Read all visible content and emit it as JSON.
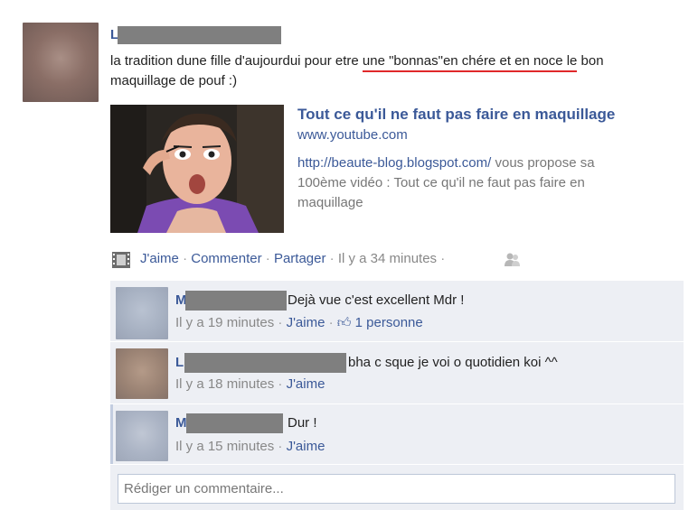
{
  "post": {
    "author_initial": "L",
    "text_line1_a": "la tradition dune fille d'aujourdui pour etre ",
    "text_line1_b": "une \"bonnas\"en chére et en noce le",
    "text_line1_c": " bon",
    "text_line2": "maquillage de pouf :)",
    "link": {
      "title": "Tout ce qu'il ne faut pas faire en maquillage",
      "domain": "www.youtube.com",
      "desc_link": "http://beaute-blog.blogspot.com/",
      "desc_line1_rest": " vous propose sa",
      "desc_line2": "100ème vidéo : Tout ce qu'il ne faut pas faire en",
      "desc_line3": "maquillage"
    },
    "actions": {
      "like": "J'aime",
      "comment": "Commenter",
      "share": "Partager",
      "time": "Il y a 34 minutes",
      "sep": "·"
    }
  },
  "comments": [
    {
      "initial": "M",
      "text": "Dejà vue c'est excellent Mdr !",
      "time": "Il y a 19 minutes",
      "like": "J'aime",
      "likes_count": "1 personne"
    },
    {
      "initial": "L",
      "text": "bha c sque je voi o quotidien koi ^^",
      "time": "Il y a 18 minutes",
      "like": "J'aime"
    },
    {
      "initial": "M",
      "text": "Dur !",
      "time": "Il y a 15 minutes",
      "like": "J'aime"
    }
  ],
  "composer": {
    "placeholder": "Rédiger un commentaire..."
  },
  "colors": {
    "link": "#3b5998",
    "comment_bg": "#edeff4",
    "underline": "#e0282a"
  }
}
